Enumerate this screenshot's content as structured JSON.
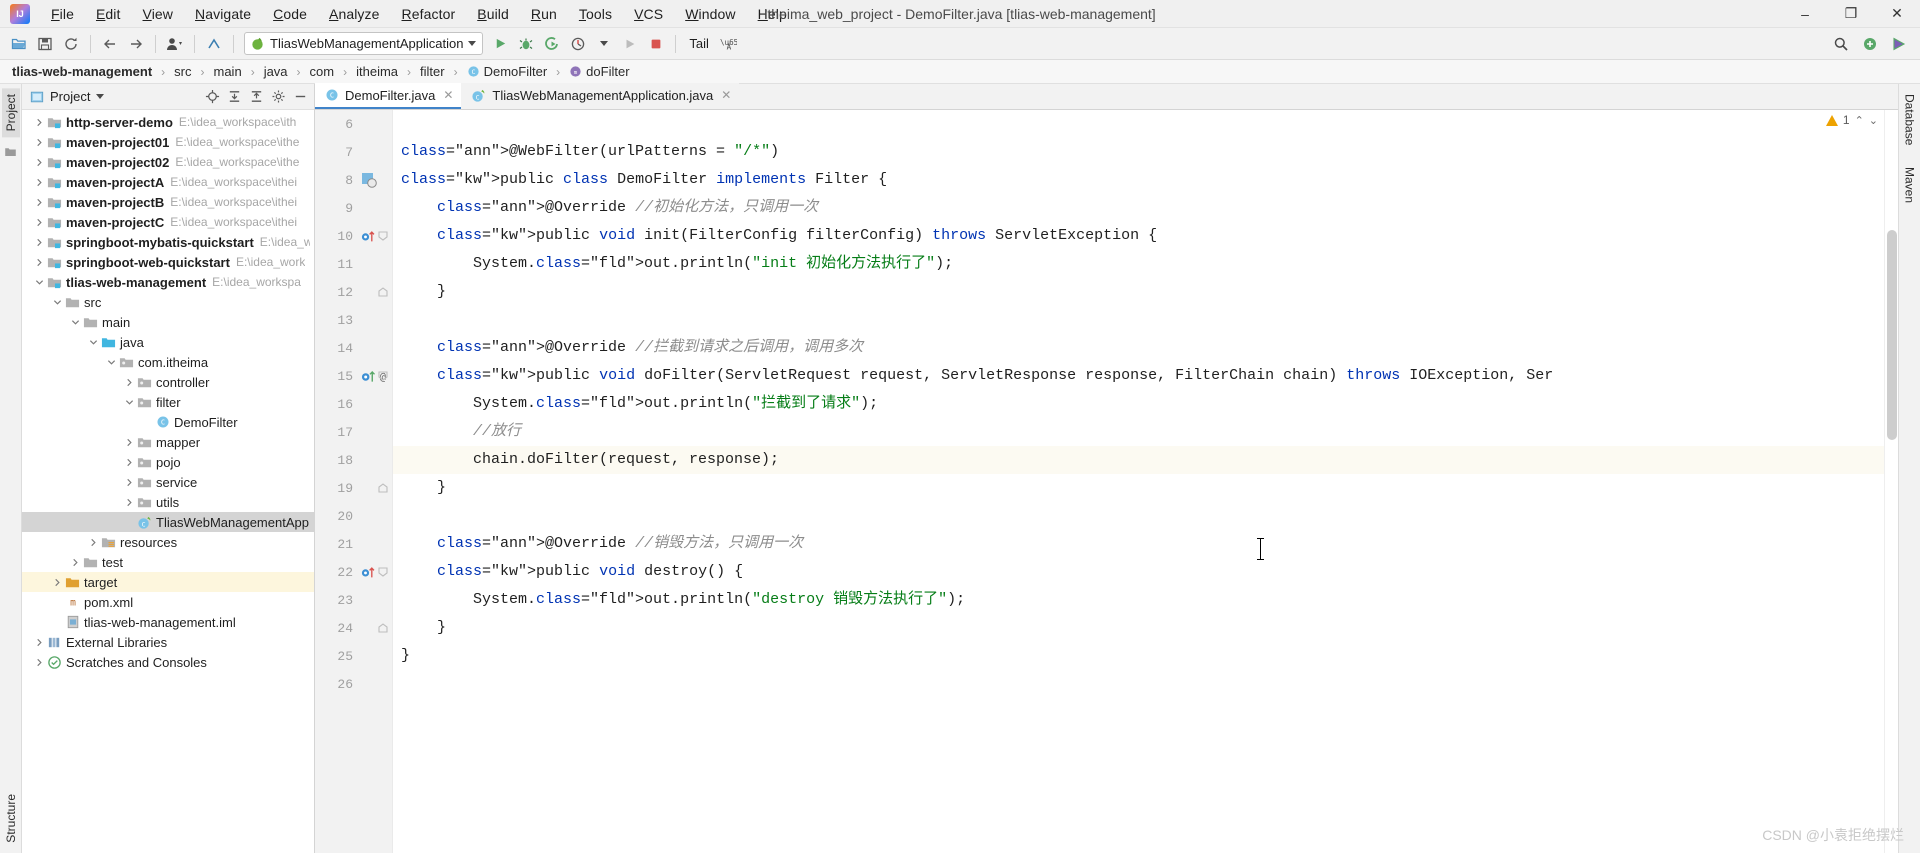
{
  "window": {
    "title": "itheima_web_project - DemoFilter.java [tlias-web-management]",
    "minimize": "–",
    "maximize": "❐",
    "close": "✕"
  },
  "menubar": {
    "items": [
      "File",
      "Edit",
      "View",
      "Navigate",
      "Code",
      "Analyze",
      "Refactor",
      "Build",
      "Run",
      "Tools",
      "VCS",
      "Window",
      "Help"
    ]
  },
  "toolbar": {
    "run_config": "TliasWebManagementApplication",
    "tail_label": "Tail",
    "icons": [
      "open-folder-icon",
      "save-icon",
      "sync-icon",
      "back-arrow-icon",
      "forward-arrow-icon",
      "user-profile-icon",
      "update-project-icon"
    ],
    "run_icons": [
      "run-icon",
      "debug-icon",
      "run-with-coverage-icon",
      "profiler-icon",
      "stop-icon"
    ],
    "right_icons": [
      "search-everywhere-icon",
      "plugin-update-icon",
      "browser-run-icon"
    ]
  },
  "breadcrumb": {
    "items": [
      {
        "label": "tlias-web-management",
        "icon": "",
        "bold": true
      },
      {
        "label": "src",
        "icon": "",
        "bold": false
      },
      {
        "label": "main",
        "icon": "",
        "bold": false
      },
      {
        "label": "java",
        "icon": "",
        "bold": false
      },
      {
        "label": "com",
        "icon": "",
        "bold": false
      },
      {
        "label": "itheima",
        "icon": "",
        "bold": false
      },
      {
        "label": "filter",
        "icon": "",
        "bold": false
      },
      {
        "label": "DemoFilter",
        "icon": "class-icon",
        "bold": false
      },
      {
        "label": "doFilter",
        "icon": "method-icon",
        "bold": false
      }
    ],
    "separator": "›"
  },
  "left_strip": {
    "tabs": [
      "Project",
      "Structure"
    ],
    "selected": "Project",
    "favorites_icon": "folder-icon"
  },
  "right_strip": {
    "tabs": [
      "Database",
      "Maven"
    ]
  },
  "project_panel": {
    "title": "Project",
    "header_icons": [
      "locate-icon",
      "expand-all-icon",
      "collapse-all-icon",
      "settings-gear-icon",
      "hide-icon"
    ],
    "tree": [
      {
        "label": "http-server-demo",
        "path": "E:\\idea_workspace\\ith",
        "depth": 0,
        "arrow": "right",
        "icon": "module-folder-icon",
        "bold": true
      },
      {
        "label": "maven-project01",
        "path": "E:\\idea_workspace\\ithe",
        "depth": 0,
        "arrow": "right",
        "icon": "module-folder-icon",
        "bold": true
      },
      {
        "label": "maven-project02",
        "path": "E:\\idea_workspace\\ithe",
        "depth": 0,
        "arrow": "right",
        "icon": "module-folder-icon",
        "bold": true
      },
      {
        "label": "maven-projectA",
        "path": "E:\\idea_workspace\\ithei",
        "depth": 0,
        "arrow": "right",
        "icon": "module-folder-icon",
        "bold": true
      },
      {
        "label": "maven-projectB",
        "path": "E:\\idea_workspace\\ithei",
        "depth": 0,
        "arrow": "right",
        "icon": "module-folder-icon",
        "bold": true
      },
      {
        "label": "maven-projectC",
        "path": "E:\\idea_workspace\\ithei",
        "depth": 0,
        "arrow": "right",
        "icon": "module-folder-icon",
        "bold": true
      },
      {
        "label": "springboot-mybatis-quickstart",
        "path": "E:\\idea_w",
        "depth": 0,
        "arrow": "right",
        "icon": "module-folder-icon",
        "bold": true
      },
      {
        "label": "springboot-web-quickstart",
        "path": "E:\\idea_work",
        "depth": 0,
        "arrow": "right",
        "icon": "module-folder-icon",
        "bold": true
      },
      {
        "label": "tlias-web-management",
        "path": "E:\\idea_workspa",
        "depth": 0,
        "arrow": "down",
        "icon": "module-folder-icon",
        "bold": true
      },
      {
        "label": "src",
        "path": "",
        "depth": 1,
        "arrow": "down",
        "icon": "folder-icon",
        "bold": false
      },
      {
        "label": "main",
        "path": "",
        "depth": 2,
        "arrow": "down",
        "icon": "folder-icon",
        "bold": false
      },
      {
        "label": "java",
        "path": "",
        "depth": 3,
        "arrow": "down",
        "icon": "source-folder-icon",
        "bold": false
      },
      {
        "label": "com.itheima",
        "path": "",
        "depth": 4,
        "arrow": "down",
        "icon": "package-icon",
        "bold": false
      },
      {
        "label": "controller",
        "path": "",
        "depth": 5,
        "arrow": "right",
        "icon": "package-icon",
        "bold": false
      },
      {
        "label": "filter",
        "path": "",
        "depth": 5,
        "arrow": "down",
        "icon": "package-icon",
        "bold": false
      },
      {
        "label": "DemoFilter",
        "path": "",
        "depth": 6,
        "arrow": "none",
        "icon": "class-icon",
        "bold": false
      },
      {
        "label": "mapper",
        "path": "",
        "depth": 5,
        "arrow": "right",
        "icon": "package-icon",
        "bold": false
      },
      {
        "label": "pojo",
        "path": "",
        "depth": 5,
        "arrow": "right",
        "icon": "package-icon",
        "bold": false
      },
      {
        "label": "service",
        "path": "",
        "depth": 5,
        "arrow": "right",
        "icon": "package-icon",
        "bold": false
      },
      {
        "label": "utils",
        "path": "",
        "depth": 5,
        "arrow": "right",
        "icon": "package-icon",
        "bold": false
      },
      {
        "label": "TliasWebManagementApp",
        "path": "",
        "depth": 5,
        "arrow": "none",
        "icon": "spring-class-icon",
        "bold": false,
        "state": "selected"
      },
      {
        "label": "resources",
        "path": "",
        "depth": 3,
        "arrow": "right",
        "icon": "resources-folder-icon",
        "bold": false
      },
      {
        "label": "test",
        "path": "",
        "depth": 2,
        "arrow": "right",
        "icon": "folder-icon",
        "bold": false
      },
      {
        "label": "target",
        "path": "",
        "depth": 1,
        "arrow": "right",
        "icon": "target-folder-icon",
        "bold": false,
        "state": "highlight"
      },
      {
        "label": "pom.xml",
        "path": "",
        "depth": 1,
        "arrow": "none",
        "icon": "maven-xml-icon",
        "bold": false
      },
      {
        "label": "tlias-web-management.iml",
        "path": "",
        "depth": 1,
        "arrow": "none",
        "icon": "iml-icon",
        "bold": false
      },
      {
        "label": "External Libraries",
        "path": "",
        "depth": 0,
        "arrow": "right",
        "icon": "libraries-icon",
        "bold": false
      },
      {
        "label": "Scratches and Consoles",
        "path": "",
        "depth": 0,
        "arrow": "right",
        "icon": "scratches-icon",
        "bold": false
      }
    ]
  },
  "editor": {
    "tabs": [
      {
        "label": "DemoFilter.java",
        "icon": "class-icon",
        "active": true
      },
      {
        "label": "TliasWebManagementApplication.java",
        "icon": "spring-class-icon",
        "active": false
      }
    ],
    "close_glyph": "✕",
    "inspection": {
      "warning_count": "1",
      "up_glyph": "⌃",
      "down_glyph": "⌄"
    },
    "first_line_number": 6,
    "lines": [
      {
        "n": 6,
        "text": "",
        "marker": "",
        "fold": "",
        "highlight": false
      },
      {
        "n": 7,
        "text": "@WebFilter(urlPatterns = \"/*\")",
        "marker": "",
        "fold": "",
        "highlight": false
      },
      {
        "n": 8,
        "text": "public class DemoFilter implements Filter {",
        "marker": "bean",
        "fold": "",
        "highlight": false
      },
      {
        "n": 9,
        "text": "    @Override //初始化方法，只调用一次",
        "marker": "",
        "fold": "",
        "highlight": false
      },
      {
        "n": 10,
        "text": "    public void init(FilterConfig filterConfig) throws ServletException {",
        "marker": "override",
        "fold": "open",
        "highlight": false
      },
      {
        "n": 11,
        "text": "        System.out.println(\"init 初始化方法执行了\");",
        "marker": "",
        "fold": "",
        "highlight": false
      },
      {
        "n": 12,
        "text": "    }",
        "marker": "",
        "fold": "close",
        "highlight": false
      },
      {
        "n": 13,
        "text": "",
        "marker": "",
        "fold": "",
        "highlight": false
      },
      {
        "n": 14,
        "text": "    @Override //拦截到请求之后调用，调用多次",
        "marker": "",
        "fold": "",
        "highlight": false
      },
      {
        "n": 15,
        "text": "    public void doFilter(ServletRequest request, ServletResponse response, FilterChain chain) throws IOException, Ser",
        "marker": "override-at",
        "fold": "open",
        "highlight": false
      },
      {
        "n": 16,
        "text": "        System.out.println(\"拦截到了请求\");",
        "marker": "",
        "fold": "",
        "highlight": false
      },
      {
        "n": 17,
        "text": "        //放行",
        "marker": "",
        "fold": "",
        "highlight": false
      },
      {
        "n": 18,
        "text": "        chain.doFilter(request, response);",
        "marker": "",
        "fold": "",
        "highlight": true
      },
      {
        "n": 19,
        "text": "    }",
        "marker": "",
        "fold": "close",
        "highlight": false
      },
      {
        "n": 20,
        "text": "",
        "marker": "",
        "fold": "",
        "highlight": false
      },
      {
        "n": 21,
        "text": "    @Override //销毁方法，只调用一次",
        "marker": "",
        "fold": "",
        "highlight": false
      },
      {
        "n": 22,
        "text": "    public void destroy() {",
        "marker": "override",
        "fold": "open",
        "highlight": false
      },
      {
        "n": 23,
        "text": "        System.out.println(\"destroy 销毁方法执行了\");",
        "marker": "",
        "fold": "",
        "highlight": false
      },
      {
        "n": 24,
        "text": "    }",
        "marker": "",
        "fold": "close",
        "highlight": false
      },
      {
        "n": 25,
        "text": "}",
        "marker": "",
        "fold": "",
        "highlight": false
      },
      {
        "n": 26,
        "text": "",
        "marker": "",
        "fold": "",
        "highlight": false
      }
    ]
  },
  "watermark": "CSDN @小袁拒绝摆烂",
  "colors": {
    "keyword": "#0033b3",
    "annotation": "#9e880d",
    "string": "#067d17",
    "comment": "#8c8c8c",
    "static_field": "#871094",
    "accent_tab": "#4083c9",
    "selection": "#d4d4d4",
    "warning": "#eda200"
  }
}
